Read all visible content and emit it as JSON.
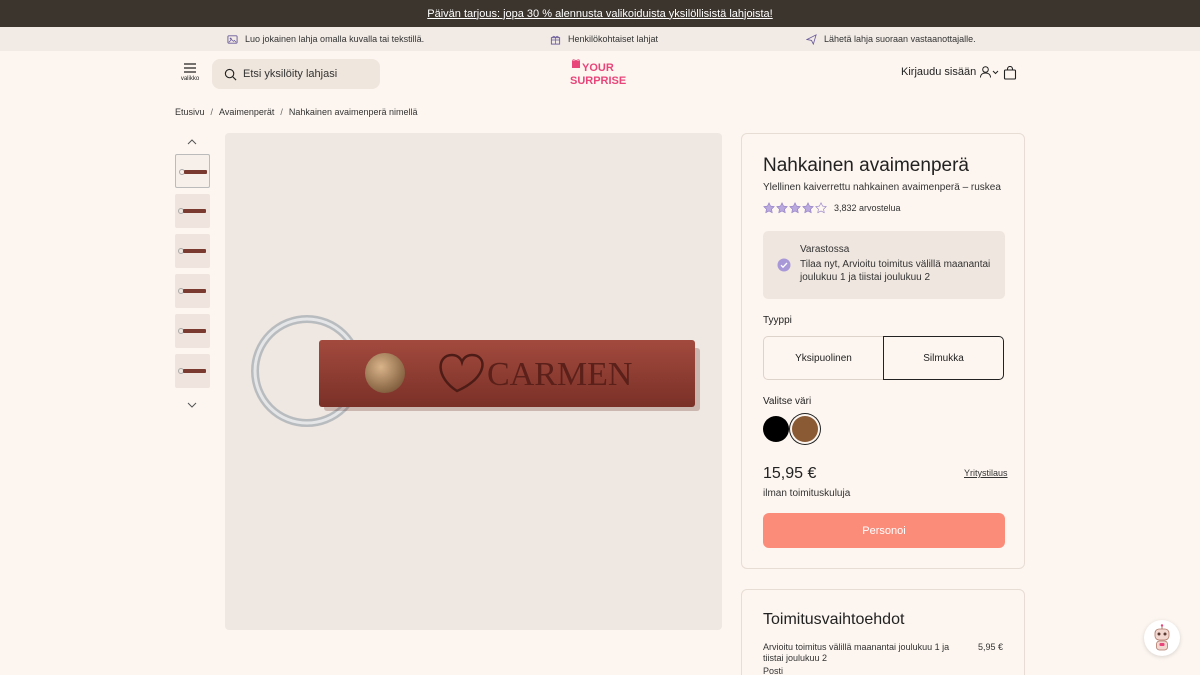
{
  "promo": {
    "text": "Päivän tarjous: jopa 30 % alennusta valikoiduista yksilöllisistä lahjoista!"
  },
  "usp": [
    {
      "icon": "image-icon",
      "text": "Luo jokainen lahja omalla kuvalla tai tekstillä."
    },
    {
      "icon": "gift-icon",
      "text": "Henkilökohtaiset lahjat"
    },
    {
      "icon": "send-icon",
      "text": "Lähetä lahja suoraan vastaanottajalle."
    }
  ],
  "header": {
    "menu_label": "valikko",
    "search_placeholder": "Etsi yksilöity lahjasi",
    "logo_line1": "YOUR",
    "logo_line2": "SURPRISE",
    "login_label": "Kirjaudu sisään"
  },
  "breadcrumb": [
    "Etusivu",
    "Avaimenperät",
    "Nahkainen avaimenperä nimellä"
  ],
  "gallery": {
    "thumbnail_count": 6,
    "active_index": 0,
    "engraving_text": "CARMEN"
  },
  "product": {
    "title": "Nahkainen avaimenperä",
    "subtitle": "Ylellinen kaiverrettu nahkainen avaimenperä – ruskea",
    "rating": 4,
    "rating_max": 5,
    "reviews_label": "3,832 arvostelua",
    "stock_title": "Varastossa",
    "stock_text": "Tilaa nyt, Arvioitu toimitus välillä maanantai joulukuu 1 ja tiistai joulukuu 2",
    "type_label": "Tyyppi",
    "type_options": [
      "Yksipuolinen",
      "Silmukka"
    ],
    "type_selected": "Silmukka",
    "color_label": "Valitse väri",
    "colors": [
      "#000000",
      "#8a5a35"
    ],
    "color_selected": "#8a5a35",
    "price": "15,95 €",
    "price_note": "ilman toimituskuluja",
    "business_link": "Yritystilaus",
    "cta": "Personoi"
  },
  "shipping": {
    "title": "Toimitusvaihtoehdot",
    "desc": "Arvioitu toimitus välillä maanantai joulukuu 1 ja tiistai joulukuu 2",
    "price": "5,95 €",
    "method": "Posti"
  },
  "colors": {
    "promo_bg": "#3b352e",
    "accent": "#fb8c7a",
    "leather": "#8a3a30",
    "logo": "#e8457a"
  }
}
